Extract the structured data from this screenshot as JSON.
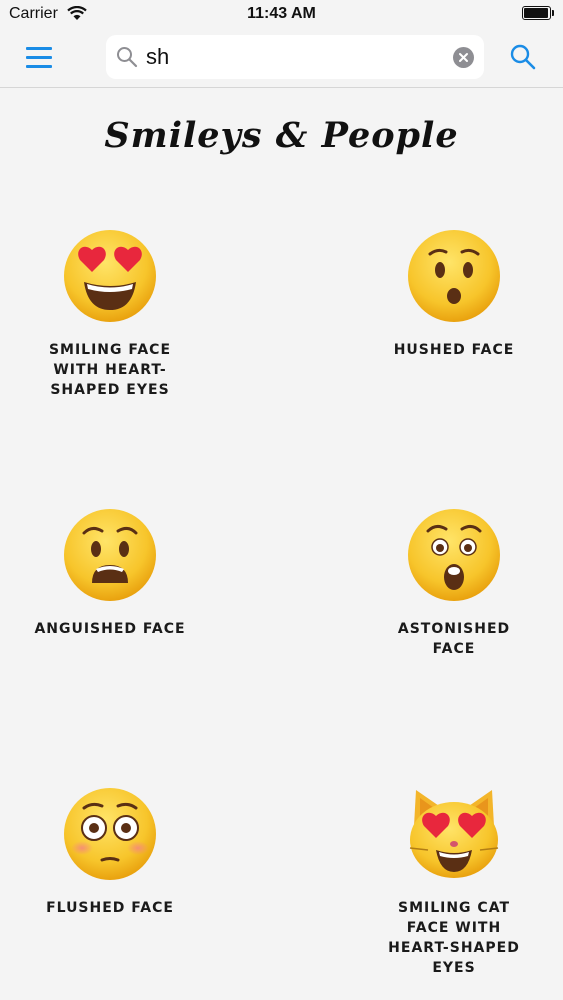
{
  "status_bar": {
    "carrier": "Carrier",
    "time": "11:43 AM"
  },
  "nav": {
    "search": {
      "value": "sh"
    }
  },
  "section": {
    "title": "Smileys & People"
  },
  "items": [
    {
      "label": "SMILING FACE WITH HEART-SHAPED EYES",
      "emoji": "heart-eyes-face"
    },
    {
      "label": "HUSHED FACE",
      "emoji": "hushed-face"
    },
    {
      "label": "ANGUISHED FACE",
      "emoji": "anguished-face"
    },
    {
      "label": "ASTONISHED FACE",
      "emoji": "astonished-face"
    },
    {
      "label": "FLUSHED FACE",
      "emoji": "flushed-face"
    },
    {
      "label": "SMILING CAT FACE WITH HEART-SHAPED EYES",
      "emoji": "heart-eyes-cat-face"
    }
  ],
  "colors": {
    "accent": "#1a8ce6",
    "face": "#f6c42f",
    "heart": "#e8273d",
    "background": "#f4f4f4"
  }
}
